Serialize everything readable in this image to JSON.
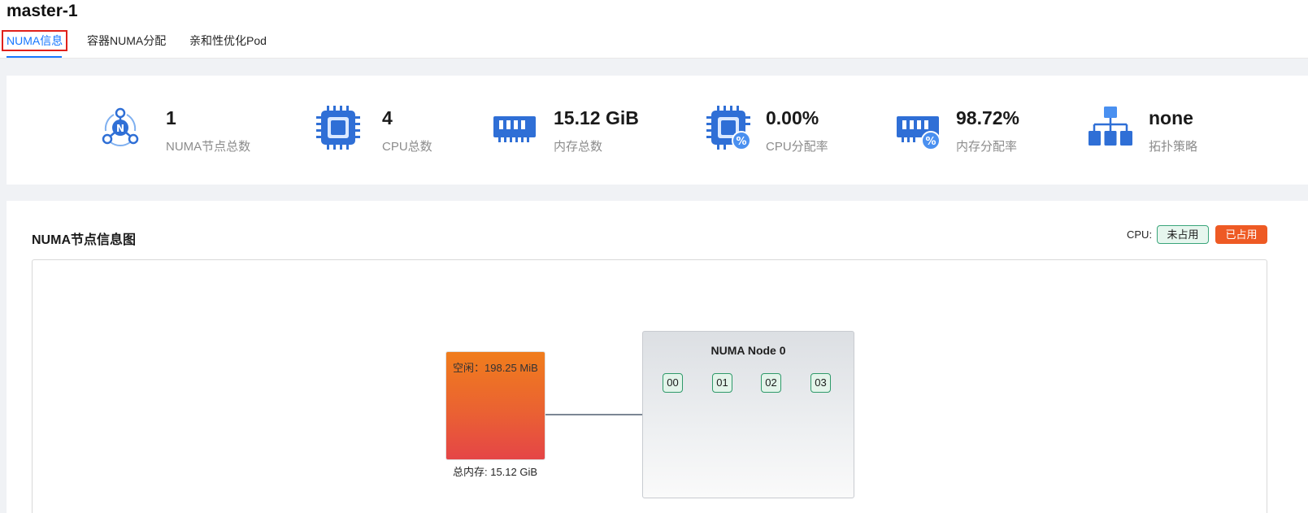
{
  "header": {
    "title": "master-1",
    "tabs": [
      {
        "label": "NUMA信息"
      },
      {
        "label": "容器NUMA分配"
      },
      {
        "label": "亲和性优化Pod"
      }
    ]
  },
  "stats": [
    {
      "value": "1",
      "label": "NUMA节点总数",
      "icon": "numa-node-icon"
    },
    {
      "value": "4",
      "label": "CPU总数",
      "icon": "cpu-chip-icon"
    },
    {
      "value": "15.12 GiB",
      "label": "内存总数",
      "icon": "memory-icon"
    },
    {
      "value": "0.00%",
      "label": "CPU分配率",
      "icon": "cpu-percent-icon"
    },
    {
      "value": "98.72%",
      "label": "内存分配率",
      "icon": "memory-percent-icon"
    },
    {
      "value": "none",
      "label": "拓扑策略",
      "icon": "topology-icon"
    }
  ],
  "numa_panel": {
    "title": "NUMA节点信息图",
    "legend": {
      "label": "CPU:",
      "free": "未占用",
      "used": "已占用"
    },
    "memory": {
      "free": "空闲：198.25 MiB",
      "total": "总内存: 15.12 GiB"
    },
    "node": {
      "title": "NUMA Node 0",
      "cpus": [
        "00",
        "01",
        "02",
        "03"
      ]
    }
  },
  "colors": {
    "accent": "#1677ff",
    "icon_blue": "#2f6fd6",
    "cpu_free_border": "#3aa57a",
    "cpu_used": "#ee5a24",
    "memory_gradient_top": "#f07d1c",
    "memory_gradient_bottom": "#e54547"
  }
}
